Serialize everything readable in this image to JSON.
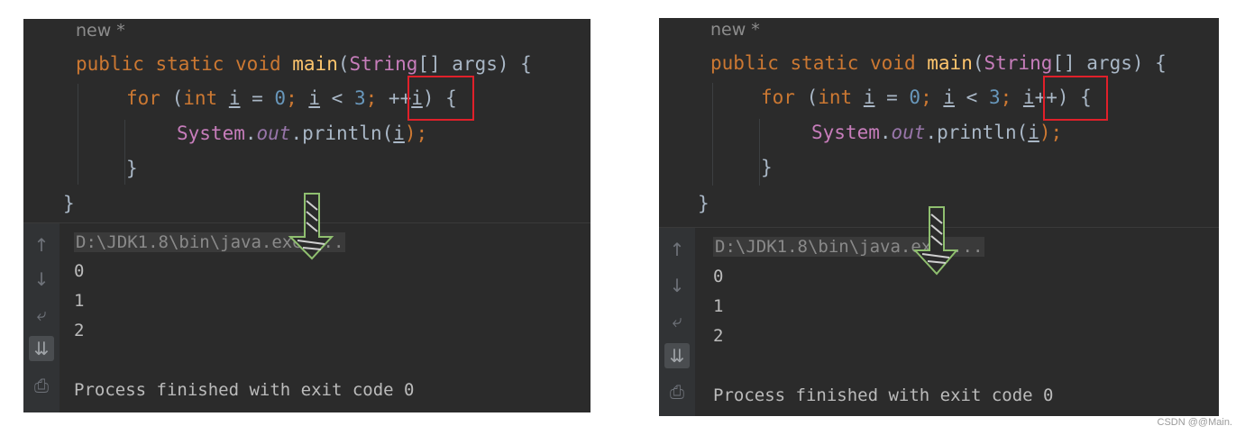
{
  "left": {
    "hint": "new *",
    "code": {
      "l1_kw1": "public",
      "l1_kw2": "static",
      "l1_kw3": "void",
      "l1_fn": "main",
      "l1_open": "(",
      "l1_type": "String",
      "l1_rest": "[] args) {",
      "l2_kw": "for",
      "l2_p1": " (",
      "l2_int": "int",
      "l2_sp": " ",
      "l2_i1": "i",
      "l2_eq": " = ",
      "l2_zero": "0",
      "l2_semi1": "; ",
      "l2_i2": "i",
      "l2_lt": " < ",
      "l2_three": "3",
      "l2_semi2": "; ",
      "l2_incr_op": "++",
      "l2_incr_var": "i",
      "l2_close": ") {",
      "l3_sys": "System",
      "l3_dot": ".",
      "l3_out": "out",
      "l3_print": ".println(",
      "l3_i": "i",
      "l3_end": ");",
      "l4": "}",
      "l5": "}"
    },
    "console": {
      "cmd": "D:\\JDK1.8\\bin\\java.exe ...",
      "lines": [
        "0",
        "1",
        "2"
      ],
      "finished": "Process finished with exit code 0"
    }
  },
  "right": {
    "hint": "new *",
    "code": {
      "l1_kw1": "public",
      "l1_kw2": "static",
      "l1_kw3": "void",
      "l1_fn": "main",
      "l1_open": "(",
      "l1_type": "String",
      "l1_rest": "[] args) {",
      "l2_kw": "for",
      "l2_p1": " (",
      "l2_int": "int",
      "l2_sp": " ",
      "l2_i1": "i",
      "l2_eq": " = ",
      "l2_zero": "0",
      "l2_semi1": "; ",
      "l2_i2": "i",
      "l2_lt": " < ",
      "l2_three": "3",
      "l2_semi2": "; ",
      "l2_incr_var": "i",
      "l2_incr_op": "++",
      "l2_close": ") {",
      "l3_sys": "System",
      "l3_dot": ".",
      "l3_out": "out",
      "l3_print": ".println(",
      "l3_i": "i",
      "l3_end": ");",
      "l4": "}",
      "l5": "}"
    },
    "console": {
      "cmd": "D:\\JDK1.8\\bin\\java.exe ...",
      "lines": [
        "0",
        "1",
        "2"
      ],
      "finished": "Process finished with exit code 0"
    }
  },
  "gutter_icons": [
    "up-arrow-icon",
    "down-arrow-icon",
    "soft-wrap-icon",
    "scroll-to-end-icon",
    "print-icon"
  ],
  "colors": {
    "highlight": "#e0202a",
    "keyword": "#cc7832",
    "function": "#ffc66d",
    "type": "#c77dbb",
    "number": "#6897bb",
    "field": "#9876aa"
  },
  "watermark": "CSDN @@Main."
}
